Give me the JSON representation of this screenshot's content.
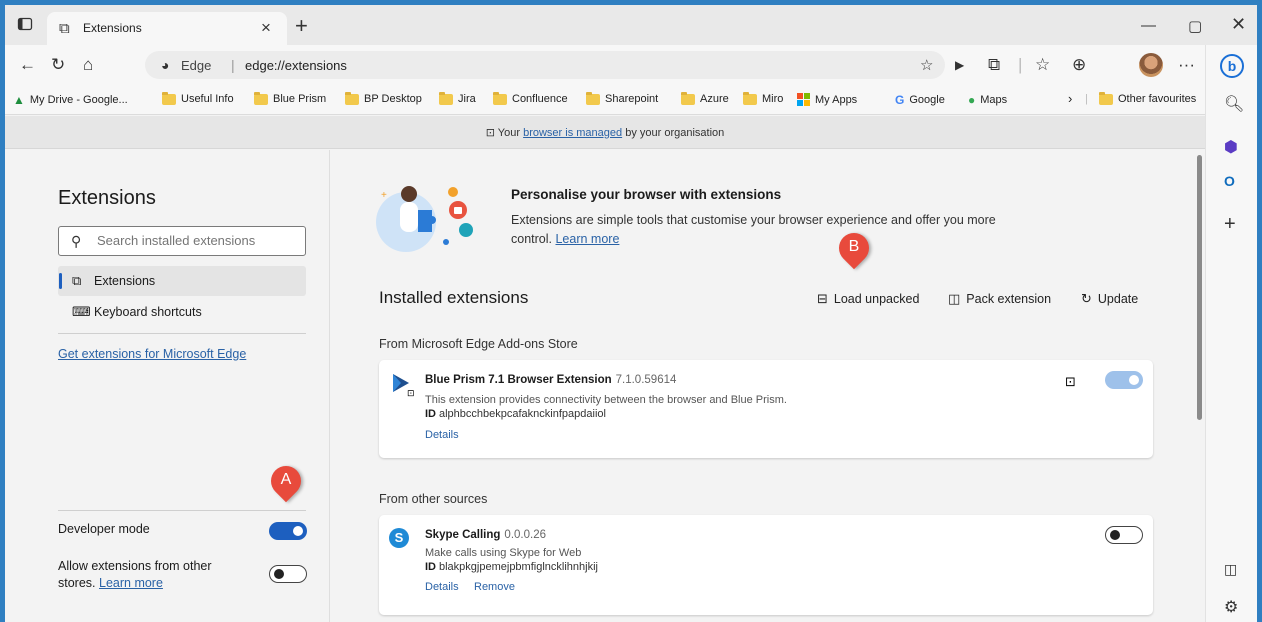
{
  "browser": {
    "tab": {
      "title": "Extensions"
    },
    "address": {
      "site_name": "Edge",
      "separator": "|",
      "url": "edge://extensions"
    },
    "bookmarks": [
      {
        "label": "My Drive - Google...",
        "icon": "google-drive-icon"
      },
      {
        "label": "Useful Info",
        "icon": "folder-icon"
      },
      {
        "label": "Blue Prism",
        "icon": "folder-icon"
      },
      {
        "label": "BP Desktop",
        "icon": "folder-icon"
      },
      {
        "label": "Jira",
        "icon": "folder-icon"
      },
      {
        "label": "Confluence",
        "icon": "folder-icon"
      },
      {
        "label": "Sharepoint",
        "icon": "folder-icon"
      },
      {
        "label": "Azure",
        "icon": "folder-icon"
      },
      {
        "label": "Miro",
        "icon": "folder-icon"
      },
      {
        "label": "My Apps",
        "icon": "microsoft-apps-icon"
      },
      {
        "label": "Google",
        "icon": "google-icon"
      },
      {
        "label": "Maps",
        "icon": "maps-pin-icon"
      }
    ],
    "other_favourites": "Other favourites",
    "managed": {
      "prefix": "Your ",
      "link": "browser is managed",
      "suffix": " by your organisation"
    }
  },
  "nav": {
    "title": "Extensions",
    "search_placeholder": "Search installed extensions",
    "items": [
      {
        "label": "Extensions"
      },
      {
        "label": "Keyboard shortcuts"
      }
    ],
    "get_extensions": "Get extensions for Microsoft Edge",
    "developer_mode": {
      "label": "Developer mode",
      "enabled": true
    },
    "allow_other_stores": {
      "label": "Allow extensions from other stores.",
      "link": "Learn more",
      "enabled": false
    }
  },
  "callouts": {
    "a": "A",
    "b": "B"
  },
  "promo": {
    "title": "Personalise your browser with extensions",
    "desc": "Extensions are simple tools that customise your browser experience and offer you more control.",
    "link": "Learn more"
  },
  "installed": {
    "title": "Installed extensions",
    "actions": {
      "load_unpacked": "Load unpacked",
      "pack": "Pack extension",
      "update": "Update"
    },
    "sections": [
      {
        "label": "From Microsoft Edge Add-ons Store",
        "extensions": [
          {
            "name": "Blue Prism 7.1 Browser Extension",
            "version": "7.1.0.59614",
            "desc": "This extension provides connectivity between the browser and Blue Prism.",
            "id_label": "ID",
            "id": "alphbcchbekpcafaknckinfpapdaiiol",
            "details": "Details",
            "enabled": true,
            "managed": true
          }
        ]
      },
      {
        "label": "From other sources",
        "extensions": [
          {
            "name": "Skype Calling",
            "version": "0.0.0.26",
            "desc": "Make calls using Skype for Web",
            "id_label": "ID",
            "id": "blakpkgjpemejpbmfiglncklihnhjkij",
            "details": "Details",
            "remove": "Remove",
            "enabled": false
          }
        ]
      }
    ]
  }
}
